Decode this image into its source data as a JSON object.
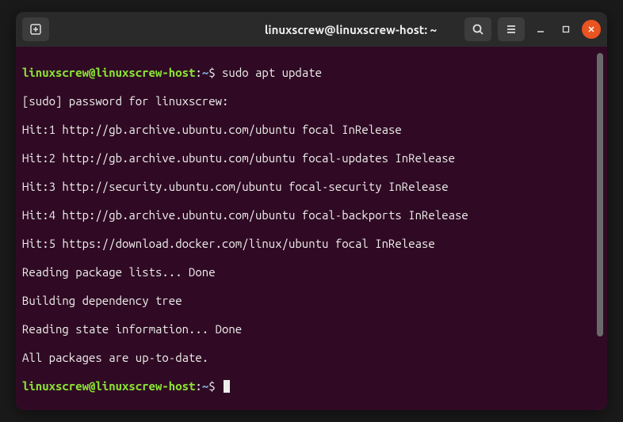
{
  "window": {
    "title": "linuxscrew@linuxscrew-host: ~"
  },
  "prompt": {
    "user_host": "linuxscrew@linuxscrew-host",
    "path": "~",
    "symbol": "$"
  },
  "commands": {
    "sudo_apt_update": "sudo apt update"
  },
  "output": {
    "line1": "[sudo] password for linuxscrew:",
    "line2": "Hit:1 http://gb.archive.ubuntu.com/ubuntu focal InRelease",
    "line3": "Hit:2 http://gb.archive.ubuntu.com/ubuntu focal-updates InRelease",
    "line4": "Hit:3 http://security.ubuntu.com/ubuntu focal-security InRelease",
    "line5": "Hit:4 http://gb.archive.ubuntu.com/ubuntu focal-backports InRelease",
    "line6": "Hit:5 https://download.docker.com/linux/ubuntu focal InRelease",
    "line7": "Reading package lists... Done",
    "line8": "Building dependency tree",
    "line9": "Reading state information... Done",
    "line10": "All packages are up-to-date."
  },
  "colors": {
    "terminal_bg": "#300a24",
    "user_host": "#8ae234",
    "path": "#729fcf",
    "text": "#eeeeec",
    "close_btn": "#e95420"
  },
  "icons": {
    "new_tab": "new-tab-icon",
    "search": "search-icon",
    "menu": "hamburger-icon",
    "minimize": "minimize-icon",
    "maximize": "maximize-icon",
    "close": "close-icon"
  }
}
